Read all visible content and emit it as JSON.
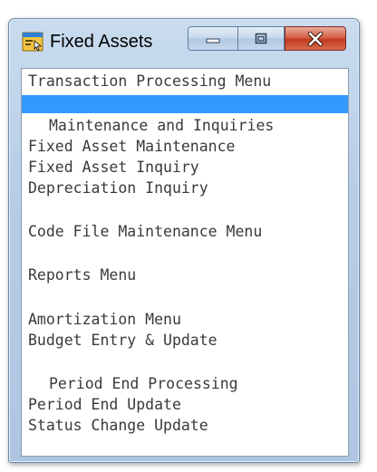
{
  "window": {
    "title": "Fixed Assets",
    "title_icon": "app-window-icon",
    "controls": {
      "minimize_icon": "minimize-icon",
      "maximize_icon": "maximize-icon",
      "close_icon": "close-icon"
    },
    "colors": {
      "frame": "#b7cde6",
      "selection": "#3399ff",
      "close_button": "#c2391d",
      "menu_text": "#3a3a3a"
    }
  },
  "menu": {
    "transaction_processing": "Transaction Processing Menu",
    "selected_blank": "",
    "maintenance_heading": "Maintenance and Inquiries",
    "fixed_asset_maintenance": "Fixed Asset Maintenance",
    "fixed_asset_inquiry": "Fixed Asset Inquiry",
    "depreciation_inquiry": "Depreciation Inquiry",
    "code_file_maintenance": "Code File Maintenance Menu",
    "reports": "Reports Menu",
    "amortization": "Amortization Menu",
    "budget_entry": "Budget Entry & Update",
    "period_end_heading": "Period End Processing",
    "period_end_update": "Period End Update",
    "status_change_update": "Status Change Update"
  }
}
